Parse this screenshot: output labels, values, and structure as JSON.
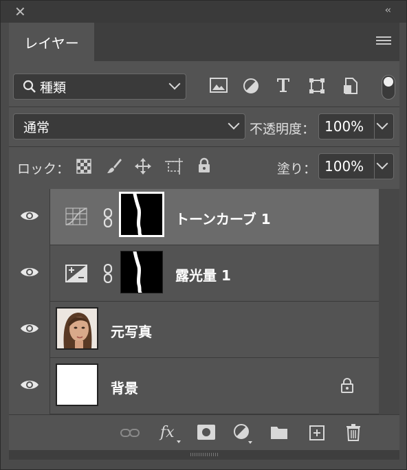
{
  "titlebar": {
    "close_glyph": "✕",
    "collapse_glyph": "‹‹"
  },
  "tab": {
    "label": "レイヤー"
  },
  "filter": {
    "icon": "search-icon",
    "kind_label": "種類"
  },
  "blend": {
    "mode": "通常",
    "opacity_label": "不透明度：",
    "opacity_value": "100%"
  },
  "lock": {
    "label": "ロック：",
    "fill_label": "塗り：",
    "fill_value": "100%"
  },
  "layers": [
    {
      "name": "トーンカーブ 1",
      "type": "curves-adjustment",
      "selected": true
    },
    {
      "name": "露光量 1",
      "type": "exposure-adjustment",
      "selected": false
    },
    {
      "name": "元写真",
      "type": "photo",
      "selected": false
    },
    {
      "name": "背景",
      "type": "background",
      "locked": true,
      "selected": false
    }
  ],
  "colors": {
    "panel": "#535353",
    "selected_row": "#6b6b6b",
    "dark": "#3a3a3a"
  }
}
